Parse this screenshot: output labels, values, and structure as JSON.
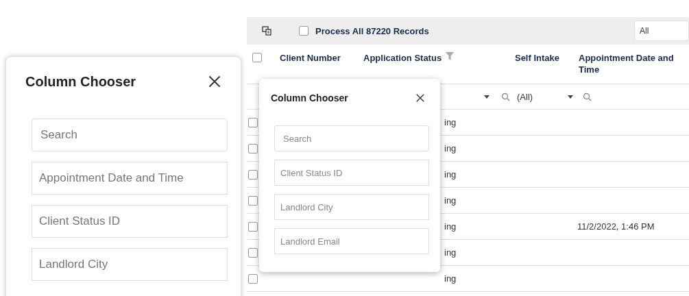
{
  "zoomed_chooser": {
    "title": "Column Chooser",
    "search": {
      "placeholder": "Search"
    },
    "columns": [
      "Appointment Date and Time",
      "Client Status ID",
      "Landlord City"
    ]
  },
  "grid": {
    "toolbar": {
      "process_all": {
        "label": "Process All 87220 Records",
        "checked": false
      },
      "filter_select": {
        "value": "All"
      }
    },
    "header": {
      "select_all_checked": false,
      "columns": [
        {
          "label": "Client Number",
          "has_filter": false
        },
        {
          "label": "Application Status",
          "has_filter": true
        },
        {
          "label": "Self Intake",
          "has_filter": false
        },
        {
          "label": "Appointment Date and Time",
          "has_filter": false
        }
      ]
    },
    "filter_row": {
      "self_intake": "(All)"
    },
    "rows": [
      {
        "checked": false,
        "status": "ing"
      },
      {
        "checked": false,
        "status": "ing"
      },
      {
        "checked": false,
        "status": "ing"
      },
      {
        "checked": false,
        "status": "ing"
      },
      {
        "checked": false,
        "status": "ing",
        "appointment": "11/2/2022, 1:46 PM"
      },
      {
        "checked": false,
        "status": "ing"
      },
      {
        "checked": false,
        "status": "ing"
      }
    ]
  },
  "column_chooser": {
    "title": "Column Chooser",
    "search": {
      "placeholder": "Search"
    },
    "columns": [
      "Client Status ID",
      "Landlord City",
      "Landlord Email"
    ]
  }
}
